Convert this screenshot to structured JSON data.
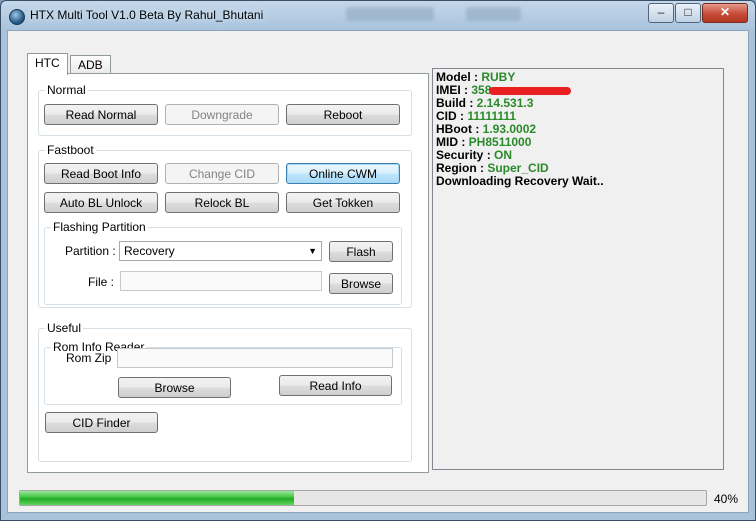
{
  "window": {
    "title": "HTX Multi Tool V1.0 Beta By Rahul_Bhutani",
    "controls": {
      "minimize": "–",
      "maximize": "□",
      "close": "✕"
    }
  },
  "tabs": [
    {
      "label": "HTC",
      "active": true
    },
    {
      "label": "ADB",
      "active": false
    }
  ],
  "normal": {
    "title": "Normal",
    "read_normal": "Read Normal",
    "downgrade": "Downgrade",
    "reboot": "Reboot"
  },
  "fastboot": {
    "title": "Fastboot",
    "read_boot_info": "Read Boot Info",
    "change_cid": "Change CID",
    "online_cwm": "Online CWM",
    "auto_bl_unlock": "Auto BL Unlock",
    "relock_bl": "Relock BL",
    "get_token": "Get Tokken"
  },
  "flashing": {
    "title": "Flashing Partition",
    "partition_label": "Partition :",
    "partition_value": "Recovery",
    "flash": "Flash",
    "file_label": "File :",
    "file_value": "",
    "browse": "Browse"
  },
  "useful": {
    "title": "Useful",
    "rom_info_title": "Rom Info Reader",
    "rom_zip_label": "Rom Zip",
    "rom_zip_value": "",
    "browse": "Browse",
    "read_info": "Read Info",
    "cid_finder": "CID Finder"
  },
  "log": {
    "model_key": "Model :",
    "model_val": "RUBY",
    "imei_key": "IMEI :",
    "imei_val": "358",
    "build_key": "Build :",
    "build_val": "2.14.531.3",
    "cid_key": "CID :",
    "cid_val": "11111111",
    "hboot_key": "HBoot :",
    "hboot_val": "1.93.0002",
    "mid_key": "MID :",
    "mid_val": "PH8511000",
    "security_key": "Security :",
    "security_val": "ON",
    "region_key": "Region :",
    "region_val": "Super_CID",
    "status": "Downloading Recovery Wait.."
  },
  "progress": {
    "value": 0.4,
    "label": "40%"
  },
  "colors": {
    "log_value": "#2a8a2a",
    "progress": "#22aa22",
    "redaction": "#e82020"
  }
}
